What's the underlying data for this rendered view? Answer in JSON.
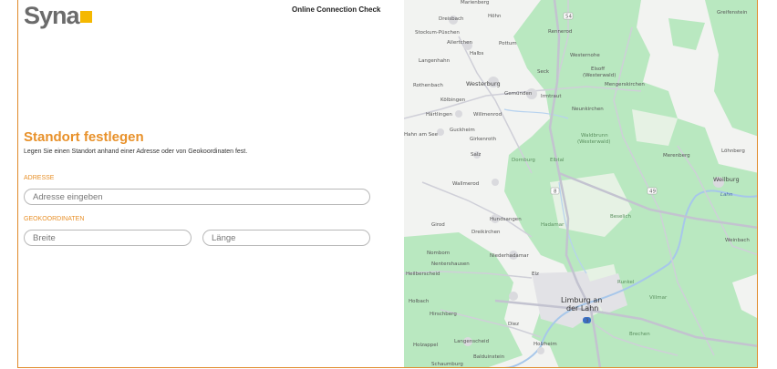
{
  "header": {
    "logo_text": "Syna",
    "logo_accent_color": "#f5b800",
    "app_title": "Online Connection Check"
  },
  "location_form": {
    "title": "Standort festlegen",
    "description": "Legen Sie einen Standort anhand einer Adresse oder von Geokoordinaten fest.",
    "address_label": "ADRESSE",
    "address_placeholder": "Adresse eingeben",
    "coords_label": "GEOKOORDINATEN",
    "latitude_placeholder": "Breite",
    "longitude_placeholder": "Länge",
    "accent_color": "#e8912a"
  },
  "map": {
    "places": {
      "marienberg": "Marienberg",
      "dreisbach": "Dreisbach",
      "hoehn": "Höhn",
      "rennerod": "Rennerod",
      "greifenstein": "Greifenstein",
      "stockum": "Stockum-Püschen",
      "ailertchen": "Ailertchen",
      "pottum": "Pottum",
      "halbs": "Halbs",
      "westernohe": "Westernohe",
      "langenhahn": "Langenhahn",
      "seck": "Seck",
      "elsoff": "Elsoff",
      "elsoff2": "(Westerwald)",
      "rothenbach": "Rothenbach",
      "westerburg": "Westerburg",
      "mengerskirchen": "Mengerskirchen",
      "gemuenden": "Gemünden",
      "irmtraut": "Irmtraut",
      "koelbingen": "Kölbingen",
      "neunkirchen": "Neunkirchen",
      "haertlingen": "Härtlingen",
      "willmenrod": "Willmenrod",
      "hahn": "Hahn am See",
      "guckheim": "Guckheim",
      "girkenroth": "Girkenroth",
      "waldbrunn": "Waldbrunn",
      "waldbrunn2": "(Westerwald)",
      "loehnberg": "Löhnberg",
      "salz": "Salz",
      "dornburg": "Dornburg",
      "elbtal": "Elbtal",
      "merenberg": "Merenberg",
      "weilburg": "Weilburg",
      "wallmerod": "Wallmerod",
      "lahn": "Lahn",
      "girod": "Girod",
      "hundsangen": "Hundsangen",
      "hadamar": "Hadamar",
      "beselich": "Beselich",
      "dreikirchen": "Dreikirchen",
      "weinbach": "Weinbach",
      "nomborn": "Nomborn",
      "niederhadamar": "Niederhadamar",
      "nentershausen": "Nentershausen",
      "heilberscheid": "Heilberscheid",
      "elz": "Elz",
      "runkel": "Runkel",
      "villmar": "Villmar",
      "hoelbach": "Holbach",
      "limburg1": "Limburg an",
      "limburg2": "der Lahn",
      "hirschberg": "Hirschberg",
      "diez": "Diez",
      "brechen": "Brechen",
      "holzappel": "Holzappel",
      "langenscheid": "Langenscheid",
      "holzheim": "Holzheim",
      "balduinstein": "Balduinstein",
      "schaumburg": "Schaumburg"
    },
    "road_numbers": {
      "b54": "54",
      "b49": "49",
      "b8": "8",
      "a3": "3"
    }
  }
}
